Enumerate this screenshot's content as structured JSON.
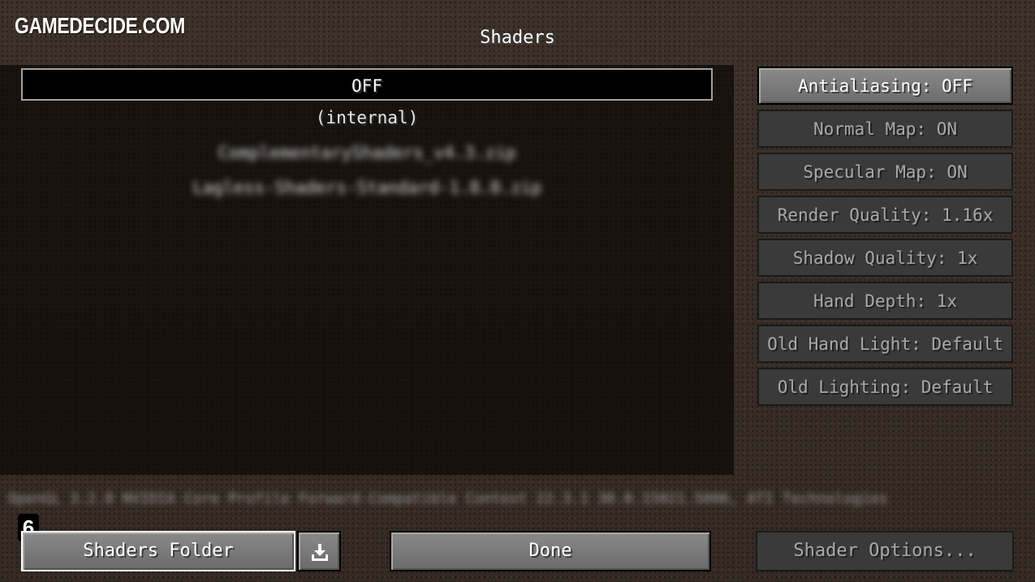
{
  "watermark": "GAMEDECIDE.COM",
  "screen_title": "Shaders",
  "shader_list": [
    {
      "label": "OFF",
      "selected": true
    },
    {
      "label": "(internal)"
    },
    {
      "label": "ComplementaryShaders_v4.3.zip",
      "blurred": true
    },
    {
      "label": "Lagless-Shaders-Standard-1.8.0.zip",
      "blurred": true
    }
  ],
  "options": [
    {
      "label": "Antialiasing: OFF"
    },
    {
      "label": "Normal Map: ON"
    },
    {
      "label": "Specular Map: ON"
    },
    {
      "label": "Render Quality: 1.16x"
    },
    {
      "label": "Shadow Quality: 1x"
    },
    {
      "label": "Hand Depth: 1x"
    },
    {
      "label": "Old Hand Light: Default"
    },
    {
      "label": "Old Lighting: Default"
    }
  ],
  "info_line": "OpenGL 3.2.0 NVIDIA Core Profile Forward-Compatible Context 22.3.1 30.0.15021.5006, ATI Technologies",
  "footer": {
    "step_badge": "6",
    "shaders_folder_label": "Shaders Folder",
    "done_label": "Done",
    "shader_options_label": "Shader Options..."
  },
  "icons": {
    "download": "download-icon"
  }
}
